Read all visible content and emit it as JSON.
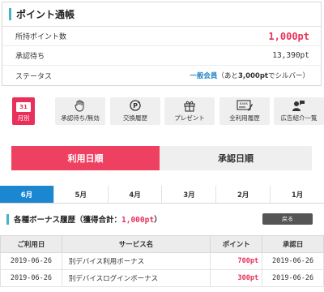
{
  "pointbook": {
    "title": "ポイント通帳",
    "rows": [
      {
        "label": "所持ポイント数",
        "value": "1,000pt"
      },
      {
        "label": "承認待ち",
        "value": "13,390pt"
      },
      {
        "label": "ステータス",
        "rank": "一般会員",
        "note_prefix": "（あと",
        "note_amount": "3,000pt",
        "note_suffix": "でシルバー）"
      }
    ]
  },
  "nav": {
    "items": [
      {
        "label": "月別",
        "icon": "calendar-icon",
        "day": "31"
      },
      {
        "label": "承認待ち/無効",
        "icon": "hand-icon"
      },
      {
        "label": "交換履歴",
        "icon": "exchange-icon",
        "glyph": "P"
      },
      {
        "label": "プレゼント",
        "icon": "gift-icon"
      },
      {
        "label": "全利用履歴",
        "icon": "card-icon",
        "glyph": "BANK"
      },
      {
        "label": "広告紹介一覧",
        "icon": "user-speech-icon"
      }
    ]
  },
  "sort": {
    "by_use_date": "利用日順",
    "by_approval_date": "承認日順"
  },
  "months": [
    "6月",
    "5月",
    "4月",
    "3月",
    "2月",
    "1月"
  ],
  "bonus": {
    "title": "各種ボーナス履歴（獲得合計：",
    "total": "1,000pt",
    "title_end": "）",
    "back_label": "戻る"
  },
  "table": {
    "headers": [
      "ご利用日",
      "サービス名",
      "ポイント",
      "承認日"
    ],
    "rows": [
      {
        "use_date": "2019-06-26",
        "service": "別デバイス利用ボーナス",
        "points": "700pt",
        "approval_date": "2019-06-26"
      },
      {
        "use_date": "2019-06-26",
        "service": "別デバイスログインボーナス",
        "points": "300pt",
        "approval_date": "2019-06-26"
      }
    ]
  },
  "colors": {
    "accent": "#e8305a",
    "blue": "#1b87d0",
    "teal": "#44b4c8"
  }
}
